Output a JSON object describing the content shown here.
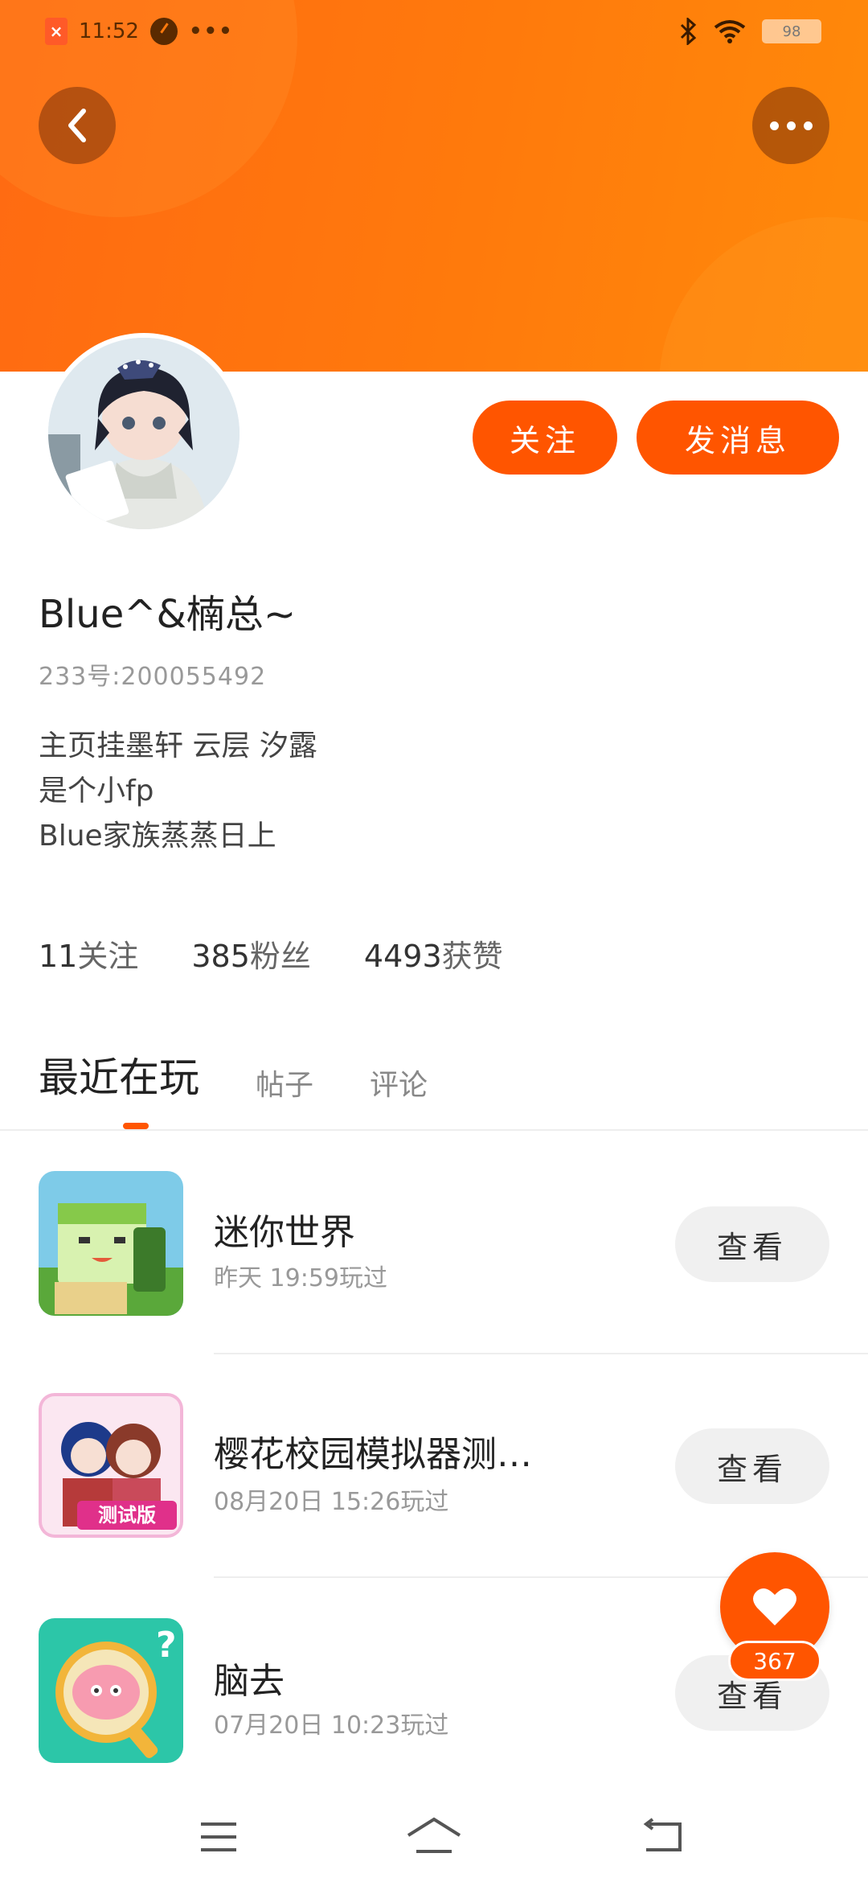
{
  "status_bar": {
    "time": "11:52",
    "dots": "•••",
    "battery": "98"
  },
  "header": {
    "back_icon": "back-arrow-icon",
    "more_icon": "more-dots-icon",
    "accent_color": "#ff5500"
  },
  "profile": {
    "follow_label": "关注",
    "message_label": "发消息",
    "username": "Blue^&楠总~",
    "uid": "233号:200055492",
    "bio": [
      "主页挂墨轩 云层 汐露",
      "是个小fp",
      "Blue家族蒸蒸日上"
    ]
  },
  "stats": [
    {
      "count": "11",
      "label": "关注"
    },
    {
      "count": "385",
      "label": "粉丝"
    },
    {
      "count": "4493",
      "label": "获赞"
    }
  ],
  "tabs": [
    {
      "label": "最近在玩",
      "active": true
    },
    {
      "label": "帖子",
      "active": false
    },
    {
      "label": "评论",
      "active": false
    }
  ],
  "games": [
    {
      "title": "迷你世界",
      "time": "昨天 19:59玩过",
      "button": "查看",
      "icon": "mini-world-icon"
    },
    {
      "title": "樱花校园模拟器测…",
      "time": "08月20日 15:26玩过",
      "button": "查看",
      "icon": "sakura-school-icon",
      "badge": "测试版"
    },
    {
      "title": "脑去",
      "time": "07月20日 10:23玩过",
      "button": "查看",
      "icon": "brain-game-icon"
    }
  ],
  "like": {
    "count": "367",
    "icon": "heart-icon"
  },
  "navbar": {
    "items": [
      "menu-icon",
      "home-icon",
      "back-icon"
    ]
  }
}
